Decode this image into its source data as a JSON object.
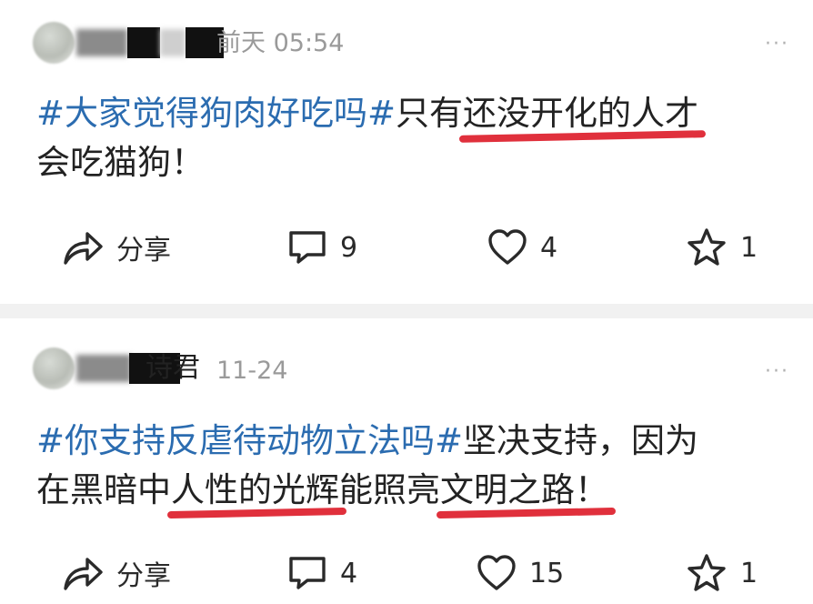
{
  "posts": [
    {
      "author_visible_suffix": "",
      "time": "前天 05:54",
      "more_icon": "···",
      "text_parts": {
        "tag": "#大家觉得狗肉好吃吗#",
        "plain1": "只有",
        "underlined": "还没开化的人才",
        "plain2": "会吃猫狗！"
      },
      "actions": {
        "share_label": "分享",
        "comments": "9",
        "likes": "4",
        "favorites": "1"
      }
    },
    {
      "author_visible_suffix": "诗君",
      "time": "11-24",
      "more_icon": "···",
      "text_parts": {
        "tag": "#你支持反虐待动物立法吗#",
        "plain1": "坚决支持，因为",
        "plain2": "在黑暗中",
        "underlined1": "人性的光辉",
        "plain3": "能照亮",
        "underlined2": "文明之路！"
      },
      "actions": {
        "share_label": "分享",
        "comments": "4",
        "likes": "15",
        "favorites": "1"
      }
    }
  ],
  "icons": {
    "share": "share-arrow-icon",
    "comment": "comment-icon",
    "like": "heart-icon",
    "favorite": "star-icon",
    "more": "more-dots-icon"
  },
  "colors": {
    "hashtag": "#2b6cb0",
    "underline_annotation": "#e0303c",
    "meta_gray": "#9a9a9a",
    "divider": "#f1f1f1"
  }
}
